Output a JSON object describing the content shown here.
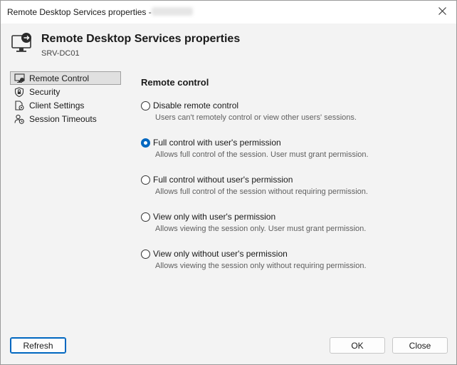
{
  "window": {
    "title": "Remote Desktop Services properties -",
    "close_glyph": "✕"
  },
  "header": {
    "title": "Remote Desktop Services properties",
    "subtitle": "SRV-DC01",
    "icon": "monitor-remote-icon"
  },
  "nav": {
    "items": [
      {
        "label": "Remote Control",
        "icon": "monitor-icon",
        "selected": true
      },
      {
        "label": "Security",
        "icon": "lock-shield-icon",
        "selected": false
      },
      {
        "label": "Client Settings",
        "icon": "document-gear-icon",
        "selected": false
      },
      {
        "label": "Session Timeouts",
        "icon": "user-clock-icon",
        "selected": false
      }
    ]
  },
  "main": {
    "section_title": "Remote control",
    "options": [
      {
        "label": "Disable remote control",
        "desc": "Users can't remotely control or view other users' sessions.",
        "checked": false
      },
      {
        "label": "Full control with user's permission",
        "desc": "Allows full control of the session. User must grant permission.",
        "checked": true
      },
      {
        "label": "Full control without user's permission",
        "desc": "Allows full control of the session without requiring permission.",
        "checked": false
      },
      {
        "label": "View only with user's permission",
        "desc": "Allows viewing the session only. User must grant permission.",
        "checked": false
      },
      {
        "label": "View only without user's permission",
        "desc": "Allows viewing the session only without requiring permission.",
        "checked": false
      }
    ]
  },
  "footer": {
    "refresh_label": "Refresh",
    "ok_label": "OK",
    "close_label": "Close"
  },
  "colors": {
    "accent": "#0067c0"
  }
}
